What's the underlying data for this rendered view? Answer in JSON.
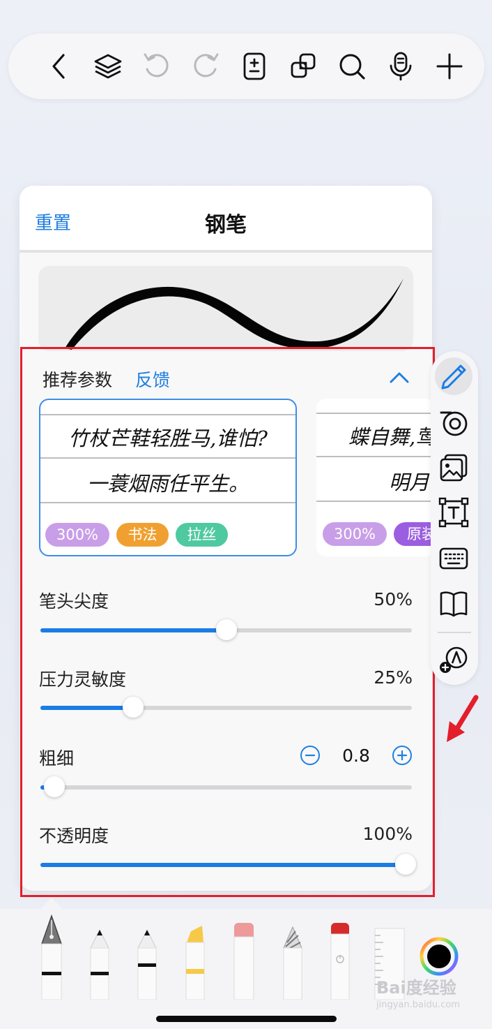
{
  "panel": {
    "reset_label": "重置",
    "title": "钢笔"
  },
  "presets": {
    "section_title": "推荐参数",
    "feedback_label": "反馈",
    "cards": [
      {
        "line1": "竹杖芒鞋轻胜马,谁怕?",
        "line2": "一蓑烟雨任平生。",
        "tags": [
          {
            "label": "300%",
            "color": "#c99ee8"
          },
          {
            "label": "书法",
            "color": "#f0a030"
          },
          {
            "label": "拉丝",
            "color": "#4fc9a0"
          }
        ]
      },
      {
        "line1": "蝶自舞,莺自",
        "line2": "明月空",
        "tags": [
          {
            "label": "300%",
            "color": "#c99ee8"
          },
          {
            "label": "原装",
            "color": "#9b5ee0"
          }
        ]
      }
    ]
  },
  "settings": {
    "tip_sharpness": {
      "label": "笔头尖度",
      "value_text": "50%",
      "value": 0.5
    },
    "pressure": {
      "label": "压力灵敏度",
      "value_text": "25%",
      "value": 0.25
    },
    "thickness": {
      "label": "粗细",
      "value_text": "0.8",
      "value": 0.03
    },
    "opacity": {
      "label": "不透明度",
      "value_text": "100%",
      "value": 1.0
    }
  },
  "colors": {
    "accent": "#1a7ce6",
    "highlight_frame": "#e41e2b",
    "current_color": "#000000"
  },
  "icons": {
    "top_bar": [
      "back-icon",
      "layers-icon",
      "undo-icon",
      "redo-icon",
      "page-add-icon",
      "duplicate-icon",
      "search-icon",
      "microphone-icon",
      "plus-icon"
    ],
    "side_bar": [
      "pen-icon",
      "tape-icon",
      "image-icon",
      "text-box-icon",
      "keyboard-icon",
      "book-icon",
      "shape-add-icon"
    ]
  },
  "watermark": {
    "text": "Bai度经验",
    "sub": "jingyan.baidu.com"
  }
}
